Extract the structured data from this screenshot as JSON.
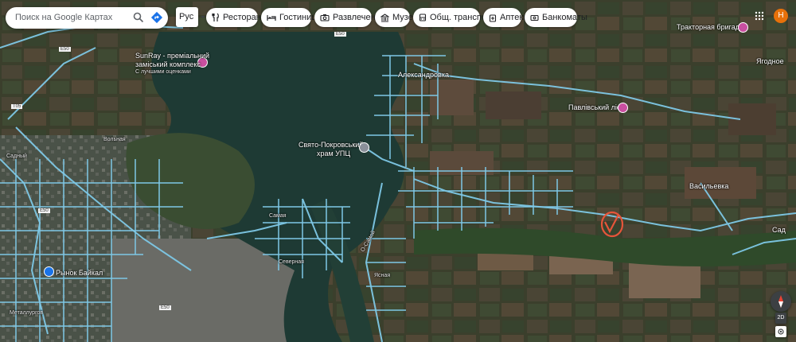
{
  "search": {
    "placeholder": "Поиск на Google Картах"
  },
  "language_button": {
    "label": "Рус"
  },
  "categories": [
    {
      "label": "Рестораны",
      "icon": "fork-knife-icon"
    },
    {
      "label": "Гостиницы",
      "icon": "bed-icon"
    },
    {
      "label": "Развлечения",
      "icon": "camera-icon"
    },
    {
      "label": "Музеи",
      "icon": "museum-icon"
    },
    {
      "label": "Общ. транспорт",
      "icon": "bus-icon"
    },
    {
      "label": "Аптеки",
      "icon": "pharmacy-icon"
    },
    {
      "label": "Банкоматы",
      "icon": "atm-icon"
    }
  ],
  "account": {
    "initial": "Н",
    "color": "#e8710a"
  },
  "map": {
    "places": [
      {
        "name": "SunRay - преміальний заміський комплекс",
        "line1": "SunRay - преміальний",
        "line2": "заміський комплекс",
        "note": "С лучшими оценками"
      },
      {
        "name": "Александровка"
      },
      {
        "name": "Павлівський ліс"
      },
      {
        "name": "Тракторная бригада"
      },
      {
        "name": "Ягодное"
      },
      {
        "name": "Свято-Покровський храм УПЦ",
        "line1": "Свято-Покровський",
        "line2": "храм УПЦ"
      },
      {
        "name": "Васильевка"
      },
      {
        "name": "Сад"
      },
      {
        "name": "Рынок Байкал"
      },
      {
        "name": "Самая"
      },
      {
        "name": "Садный"
      },
      {
        "name": "Вольная"
      },
      {
        "name": "Металлургов"
      },
      {
        "name": "Северная"
      },
      {
        "name": "Ясная"
      }
    ],
    "road_labels": [
      "Е50",
      "Т05",
      "Е50",
      "Е50",
      "Е50",
      "О-Самой"
    ],
    "colors": {
      "street_view_lines": "#7ec8e6",
      "marker": "#e6553a",
      "water": "#1e3a34"
    }
  },
  "controls": {
    "view_3d": "2D"
  }
}
